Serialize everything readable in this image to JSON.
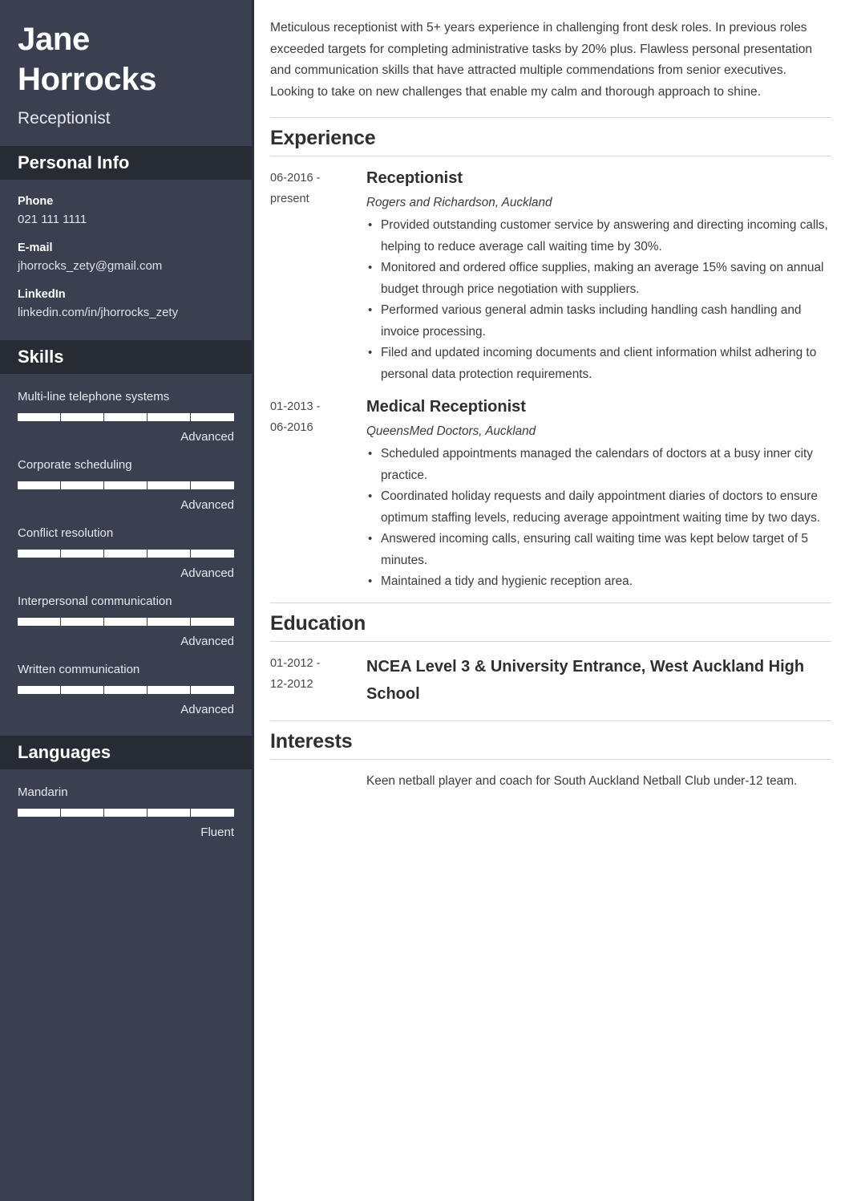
{
  "colors": {
    "sidebar_bg": "#3b4051",
    "sidebar_header_bg": "#272b34",
    "sidebar_border": "#2a2e39",
    "bar_fill": "#ffffff",
    "text_dark": "#3c3c3c",
    "rule": "#d6d6d6"
  },
  "sidebar": {
    "name": "Jane Horrocks",
    "name_line1": "Jane",
    "name_line2": "Horrocks",
    "job_title": "Receptionist",
    "personal_info": {
      "heading": "Personal Info",
      "items": [
        {
          "label": "Phone",
          "value": "021 111 1111"
        },
        {
          "label": "E-mail",
          "value": "jhorrocks_zety@gmail.com"
        },
        {
          "label": "LinkedIn",
          "value": "linkedin.com/in/jhorrocks_zety"
        }
      ]
    },
    "skills": {
      "heading": "Skills",
      "items": [
        {
          "name": "Multi-line telephone systems",
          "level": "Advanced",
          "segments": 5,
          "filled": 5
        },
        {
          "name": "Corporate scheduling",
          "level": "Advanced",
          "segments": 5,
          "filled": 5
        },
        {
          "name": "Conflict resolution",
          "level": "Advanced",
          "segments": 5,
          "filled": 5
        },
        {
          "name": "Interpersonal communication",
          "level": "Advanced",
          "segments": 5,
          "filled": 5
        },
        {
          "name": "Written communication",
          "level": "Advanced",
          "segments": 5,
          "filled": 5
        }
      ]
    },
    "languages": {
      "heading": "Languages",
      "items": [
        {
          "name": "Mandarin",
          "level": "Fluent",
          "segments": 5,
          "filled": 5
        }
      ]
    }
  },
  "main": {
    "summary": "Meticulous receptionist with 5+ years experience in challenging front desk roles. In previous roles exceeded targets for completing administrative tasks by 20% plus. Flawless personal presentation and communication skills that have attracted multiple commendations from senior executives. Looking to take on new challenges that enable my calm and thorough approach to shine.",
    "experience": {
      "heading": "Experience",
      "entries": [
        {
          "dates": "06-2016 - present",
          "dates_line1": "06-2016 -",
          "dates_line2": "present",
          "title": "Receptionist",
          "org": "Rogers and Richardson, Auckland",
          "bullets": [
            "Provided outstanding customer service by answering and directing incoming calls, helping to reduce average call waiting time by 30%.",
            "Monitored and ordered office supplies, making an average 15% saving on annual budget through price negotiation with suppliers.",
            "Performed various general admin tasks including handling cash handling and invoice processing.",
            "Filed and updated incoming documents and client information whilst adhering to personal data protection requirements."
          ]
        },
        {
          "dates": "01-2013 - 06-2016",
          "dates_line1": "01-2013 -",
          "dates_line2": "06-2016",
          "title": "Medical Receptionist",
          "org": "QueensMed Doctors, Auckland",
          "bullets": [
            "Scheduled appointments managed the calendars of doctors at a busy inner city practice.",
            "Coordinated holiday requests and daily appointment diaries of doctors to ensure optimum staffing levels, reducing average appointment waiting time by two days.",
            "Answered incoming calls, ensuring call waiting time was kept below target of 5 minutes.",
            "Maintained a tidy and hygienic reception area."
          ]
        }
      ]
    },
    "education": {
      "heading": "Education",
      "entries": [
        {
          "dates": "01-2012 - 12-2012",
          "dates_line1": "01-2012 -",
          "dates_line2": "12-2012",
          "title": "NCEA Level 3 & University Entrance, West Auckland High School"
        }
      ]
    },
    "interests": {
      "heading": "Interests",
      "text": "Keen netball player and coach for South Auckland Netball Club under-12 team."
    }
  }
}
